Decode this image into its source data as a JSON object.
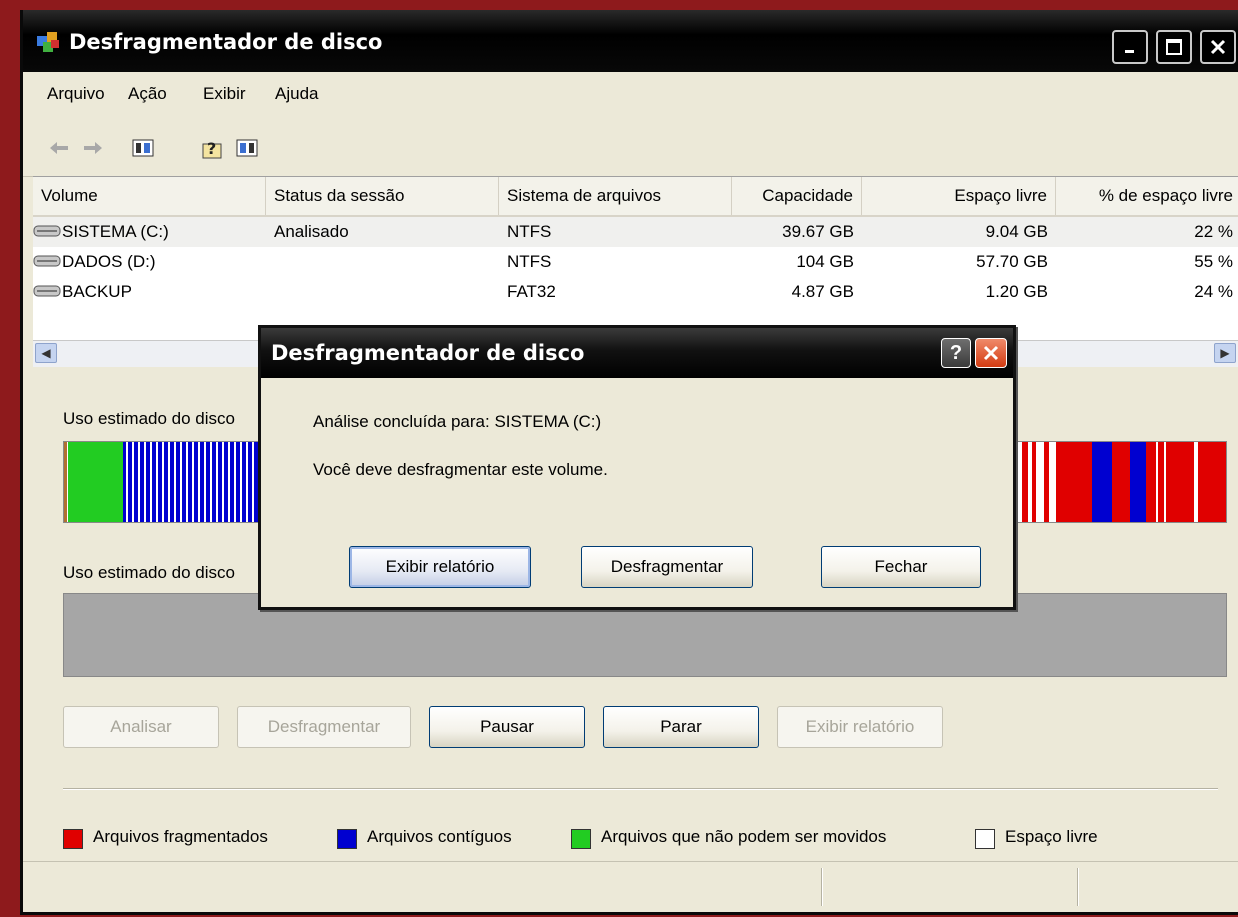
{
  "window": {
    "title": "Desfragmentador de disco",
    "controls": {
      "minimize": "minimize-icon",
      "maximize": "maximize-icon",
      "close": "close-icon"
    }
  },
  "menu": [
    "Arquivo",
    "Ação",
    "Exibir",
    "Ajuda"
  ],
  "toolbar": {
    "icons": [
      "back-arrow-icon",
      "forward-arrow-icon",
      "show-hide-console-tree-icon",
      "help-icon",
      "show-hide-action-pane-icon"
    ]
  },
  "volumes": {
    "columns": [
      "Volume",
      "Status da sessão",
      "Sistema de arquivos",
      "Capacidade",
      "Espaço livre",
      "% de espaço livre"
    ],
    "rows": [
      {
        "volume": "SISTEMA (C:)",
        "status": "Analisado",
        "fs": "NTFS",
        "capacity": "39.67 GB",
        "free": "9.04 GB",
        "pct": "22 %"
      },
      {
        "volume": "DADOS (D:)",
        "status": "",
        "fs": "NTFS",
        "capacity": "104 GB",
        "free": "57.70 GB",
        "pct": "55 %"
      },
      {
        "volume": "BACKUP",
        "status": "",
        "fs": "FAT32",
        "capacity": "4.87 GB",
        "free": "1.20 GB",
        "pct": "24 %"
      }
    ]
  },
  "lower": {
    "before_label": "Uso estimado do disco",
    "after_label": "Uso estimado do disco",
    "buttons": {
      "analyze": "Analisar",
      "defrag": "Desfragmentar",
      "pause": "Pausar",
      "stop": "Parar",
      "report": "Exibir relatório"
    }
  },
  "legend": [
    {
      "label": "Arquivos fragmentados",
      "color": "#e00000"
    },
    {
      "label": "Arquivos contíguos",
      "color": "#0000d0"
    },
    {
      "label": "Arquivos que não podem ser movidos",
      "color": "#22cc22"
    },
    {
      "label": "Espaço livre",
      "color": "#ffffff"
    }
  ],
  "dialog": {
    "title": "Desfragmentador de disco",
    "help": "?",
    "line1": "Análise concluída para: SISTEMA (C:)",
    "line2": "Você deve desfragmentar este volume.",
    "buttons": {
      "report": "Exibir relatório",
      "defrag": "Desfragmentar",
      "close": "Fechar"
    }
  }
}
